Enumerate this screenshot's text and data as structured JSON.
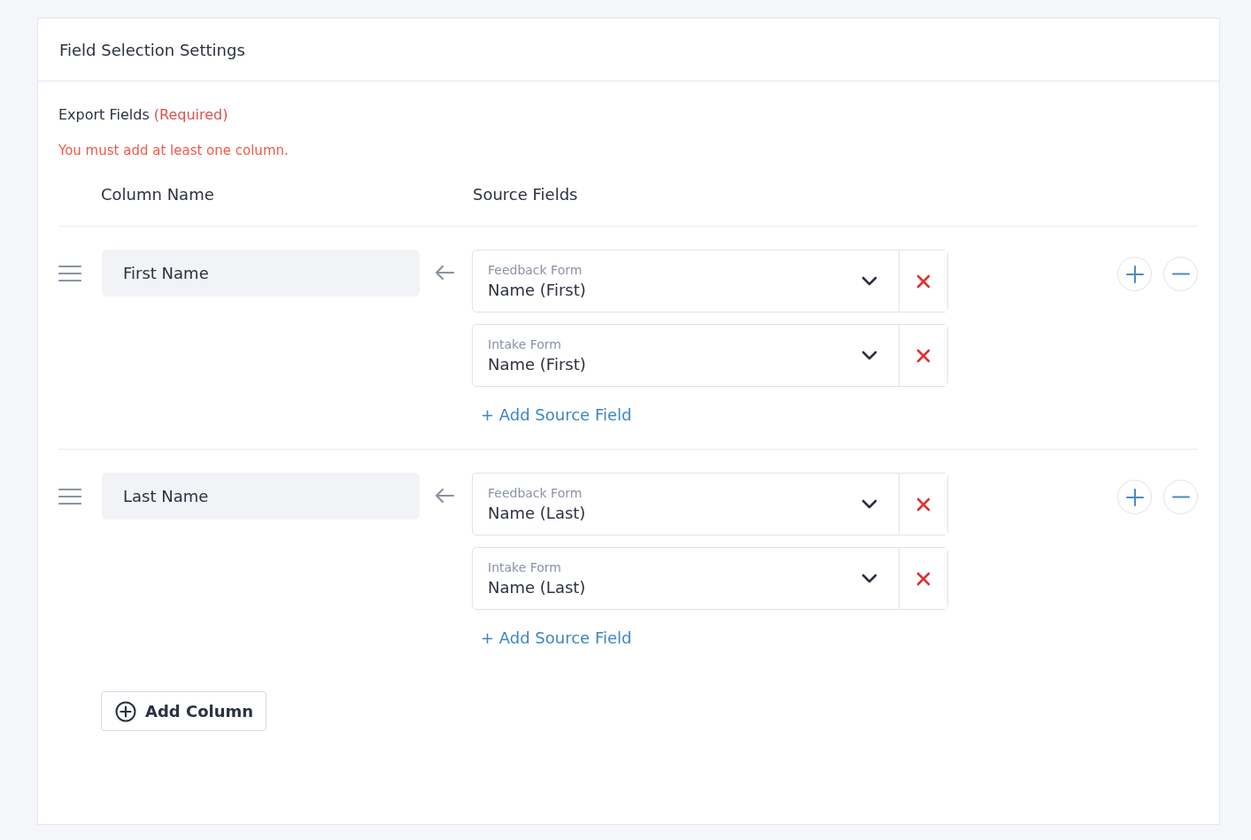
{
  "panel": {
    "title": "Field Selection Settings"
  },
  "export_fields": {
    "label": "Export Fields",
    "required_note": "(Required)",
    "error": "You must add at least one column."
  },
  "headers": {
    "column_name": "Column Name",
    "source_fields": "Source Fields"
  },
  "columns": [
    {
      "name": "First Name",
      "sources": [
        {
          "form": "Feedback Form",
          "field": "Name (First)"
        },
        {
          "form": "Intake Form",
          "field": "Name (First)"
        }
      ],
      "add_source": "+ Add Source Field"
    },
    {
      "name": "Last Name",
      "sources": [
        {
          "form": "Feedback Form",
          "field": "Name (Last)"
        },
        {
          "form": "Intake Form",
          "field": "Name (Last)"
        }
      ],
      "add_source": "+ Add Source Field"
    }
  ],
  "add_column": "Add Column"
}
